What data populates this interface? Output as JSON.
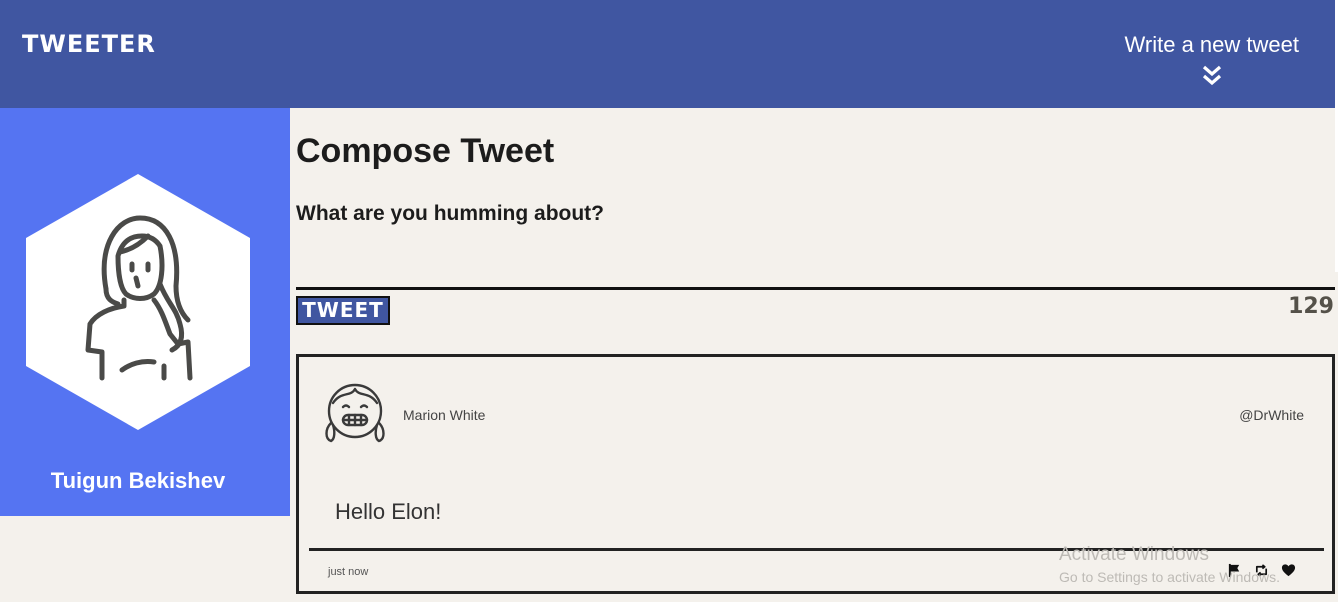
{
  "nav": {
    "brand": "TWEETER",
    "write_tweet_label": "Write a new tweet"
  },
  "profile": {
    "name": "Tuigun Bekishev"
  },
  "compose": {
    "title": "Compose Tweet",
    "placeholder": "What are you humming about?",
    "button_label": "TWEET",
    "char_counter": "129"
  },
  "tweets": [
    {
      "author_name": "Marion White",
      "handle": "@DrWhite",
      "content": "Hello Elon!",
      "time": "just now",
      "actions": [
        "flag-icon",
        "retweet-icon",
        "heart-icon"
      ]
    }
  ],
  "watermark": {
    "title": "Activate Windows",
    "subtitle": "Go to Settings to activate Windows."
  },
  "colors": {
    "nav_bg": "#4056a1",
    "profile_bg": "#5574f2",
    "page_bg": "#f4f1ec",
    "counter": "#545149"
  }
}
